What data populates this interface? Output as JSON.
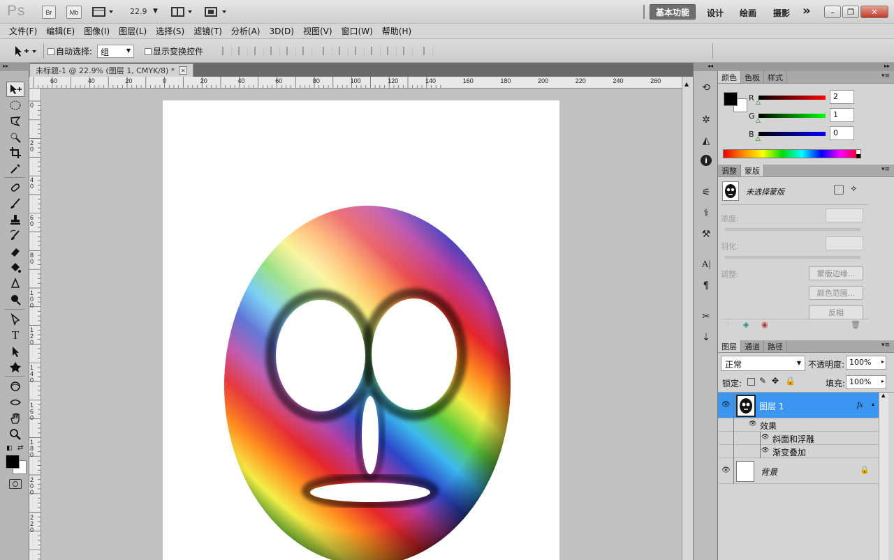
{
  "titlebar": {
    "logo": "Ps",
    "bridge_label": "Br",
    "minibridge_label": "Mb",
    "zoom_value": "22.9",
    "workspaces": [
      "基本功能",
      "设计",
      "绘画",
      "摄影"
    ],
    "more_label": "»",
    "minimize_label": "–",
    "restore_label": "❐",
    "close_label": "✕"
  },
  "menu": {
    "items": [
      "文件(F)",
      "编辑(E)",
      "图像(I)",
      "图层(L)",
      "选择(S)",
      "滤镜(T)",
      "分析(A)",
      "3D(D)",
      "视图(V)",
      "窗口(W)",
      "帮助(H)"
    ]
  },
  "options": {
    "auto_select_label": "自动选择:",
    "auto_select_value": "组",
    "show_transform_label": "显示变换控件"
  },
  "document": {
    "tab_title": "未标题-1 @ 22.9% (图层 1, CMYK/8) *",
    "tab_close": "✕"
  },
  "rulers": {
    "top": [
      "60",
      "40",
      "20",
      "0",
      "20",
      "40",
      "60",
      "80",
      "100",
      "120",
      "140",
      "160",
      "180",
      "200",
      "220",
      "240",
      "260"
    ],
    "left": [
      "0",
      "2 0",
      "4 0",
      "6 0",
      "8 0",
      "1 0 0",
      "1 2 0",
      "1 4 0",
      "1 6 0",
      "1 8 0",
      "2 0 0",
      "2 2 0"
    ]
  },
  "color_panel": {
    "tabs": [
      "颜色",
      "色板",
      "样式"
    ],
    "r_label": "R",
    "r_value": "2",
    "g_label": "G",
    "g_value": "1",
    "b_label": "B",
    "b_value": "0",
    "fg_color": "#020100",
    "bg_color": "#ffffff"
  },
  "masks_panel": {
    "tabs": [
      "调整",
      "蒙版"
    ],
    "status": "未选择蒙版",
    "density_label": "浓度:",
    "feather_label": "羽化:",
    "refine_label": "调整:",
    "mask_edge_button": "蒙版边缘...",
    "color_range_button": "颜色范围...",
    "invert_button": "反相"
  },
  "layers_panel": {
    "tabs": [
      "图层",
      "通道",
      "路径"
    ],
    "blend_mode": "正常",
    "opacity_label": "不透明度:",
    "opacity_value": "100%",
    "lock_label": "锁定:",
    "fill_label": "填充:",
    "fill_value": "100%",
    "layers": [
      {
        "name": "图层 1",
        "selected": true,
        "fx": "fx"
      },
      {
        "name": "背景",
        "selected": false
      }
    ],
    "effects_label": "效果",
    "effects": [
      "斜面和浮雕",
      "渐变叠加"
    ]
  },
  "colors": {
    "selection": "#3a96f1",
    "ws_active": "#6e6e6e"
  }
}
